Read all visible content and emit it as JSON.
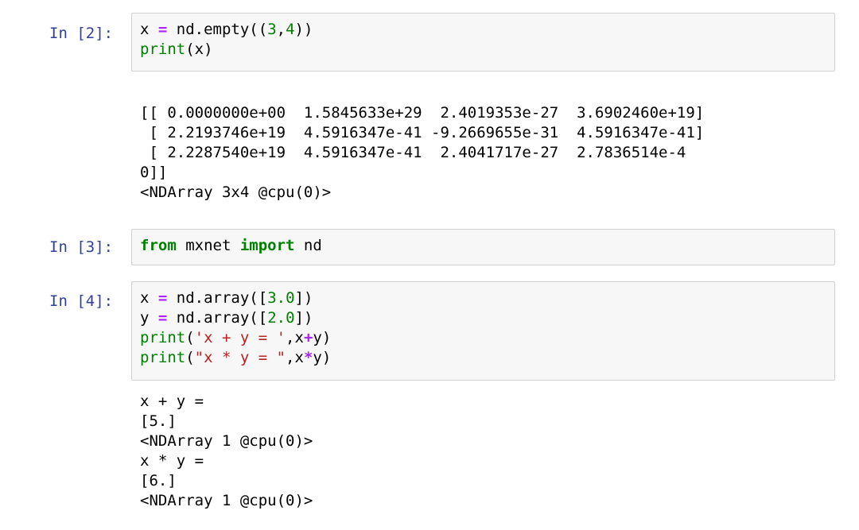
{
  "cells": [
    {
      "prompt": "In [2]:",
      "code": [
        [
          [
            "x ",
            ""
          ],
          [
            "=",
            "op"
          ],
          [
            " nd.empty((",
            ""
          ],
          [
            "3",
            "num"
          ],
          [
            ",",
            ""
          ],
          [
            "4",
            "num"
          ],
          [
            "))",
            ""
          ]
        ],
        [
          [
            "print",
            "fn"
          ],
          [
            "(x)",
            ""
          ]
        ]
      ],
      "output": [
        "[[ 0.0000000e+00  1.5845633e+29  2.4019353e-27  3.6902460e+19]",
        " [ 2.2193746e+19  4.5916347e-41 -9.2669655e-31  4.5916347e-41]",
        " [ 2.2287540e+19  4.5916347e-41  2.4041717e-27  2.7836514e-4",
        "0]]",
        "<NDArray 3x4 @cpu(0)>"
      ]
    },
    {
      "prompt": "In [3]:",
      "code": [
        [
          [
            "from",
            "kw"
          ],
          [
            " mxnet ",
            ""
          ],
          [
            "import",
            "kw"
          ],
          [
            " nd",
            ""
          ]
        ]
      ],
      "output": []
    },
    {
      "prompt": "In [4]:",
      "code": [
        [
          [
            "x ",
            ""
          ],
          [
            "=",
            "op"
          ],
          [
            " nd.array([",
            ""
          ],
          [
            "3.0",
            "num"
          ],
          [
            "])",
            ""
          ]
        ],
        [
          [
            "y ",
            ""
          ],
          [
            "=",
            "op"
          ],
          [
            " nd.array([",
            ""
          ],
          [
            "2.0",
            "num"
          ],
          [
            "])",
            ""
          ]
        ],
        [
          [
            "print",
            "fn"
          ],
          [
            "(",
            ""
          ],
          [
            "'x + y = '",
            "str"
          ],
          [
            ",x",
            ""
          ],
          [
            "+",
            "op"
          ],
          [
            "y)",
            ""
          ]
        ],
        [
          [
            "print",
            "fn"
          ],
          [
            "(",
            ""
          ],
          [
            "\"x * y = \"",
            "str"
          ],
          [
            ",x",
            ""
          ],
          [
            "*",
            "op"
          ],
          [
            "y)",
            ""
          ]
        ]
      ],
      "output": [
        "x + y =",
        "[5.]",
        "<NDArray 1 @cpu(0)>",
        "x * y =",
        "[6.]",
        "<NDArray 1 @cpu(0)>"
      ]
    }
  ]
}
